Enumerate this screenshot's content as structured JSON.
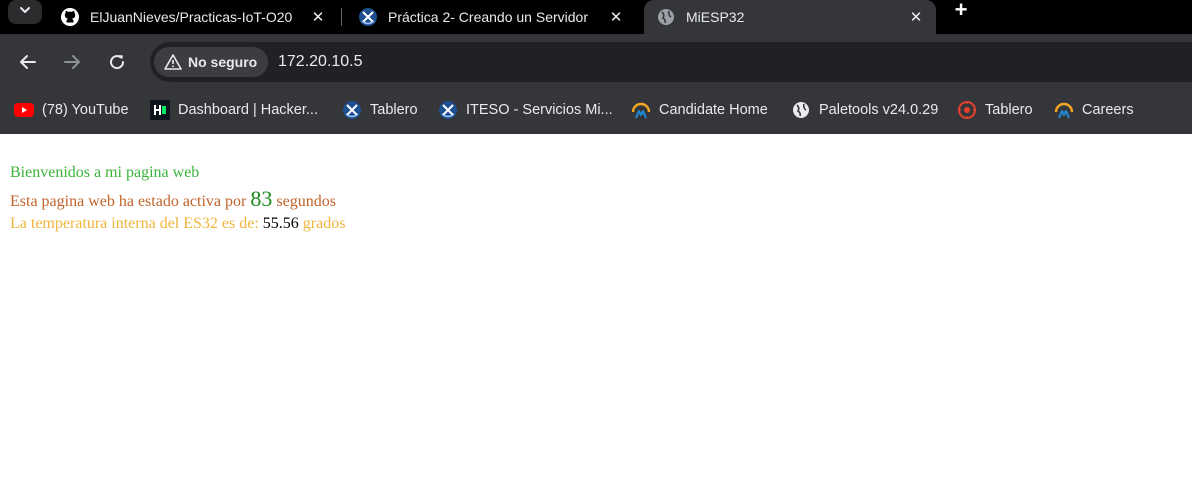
{
  "tabs": [
    {
      "title": "ElJuanNieves/Practicas-IoT-O20",
      "favicon": "github-icon"
    },
    {
      "title": "Práctica 2- Creando un Servidor",
      "favicon": "iteso-icon"
    },
    {
      "title": "MiESP32",
      "favicon": "globe-icon"
    }
  ],
  "toolbar": {
    "security_label": "No seguro",
    "url": "172.20.10.5"
  },
  "bookmarks": [
    {
      "label": "(78) YouTube",
      "icon": "youtube-icon"
    },
    {
      "label": "Dashboard | Hacker...",
      "icon": "hackerrank-icon"
    },
    {
      "label": "Tablero",
      "icon": "iteso-icon"
    },
    {
      "label": "ITESO - Servicios Mi...",
      "icon": "iteso-icon"
    },
    {
      "label": "Candidate Home",
      "icon": "candidate-icon"
    },
    {
      "label": "Paletools v24.0.29",
      "icon": "globe-icon"
    },
    {
      "label": "Tablero",
      "icon": "canvas-icon"
    },
    {
      "label": "Careers",
      "icon": "candidate-icon"
    }
  ],
  "page": {
    "welcome": "Bienvenidos a mi pagina web",
    "uptime_prefix": "Esta pagina web ha estado activa por ",
    "uptime_value": "83",
    "uptime_suffix": " segundos",
    "temp_prefix": "La temperatura interna del ES32 es de: ",
    "temp_value": "55.56",
    "temp_suffix": " grados"
  },
  "colors": {
    "welcome": "#3cb43c",
    "uptime_text": "#c0622a",
    "uptime_value": "#1a8a1a",
    "temp_text": "#f0b63c"
  }
}
